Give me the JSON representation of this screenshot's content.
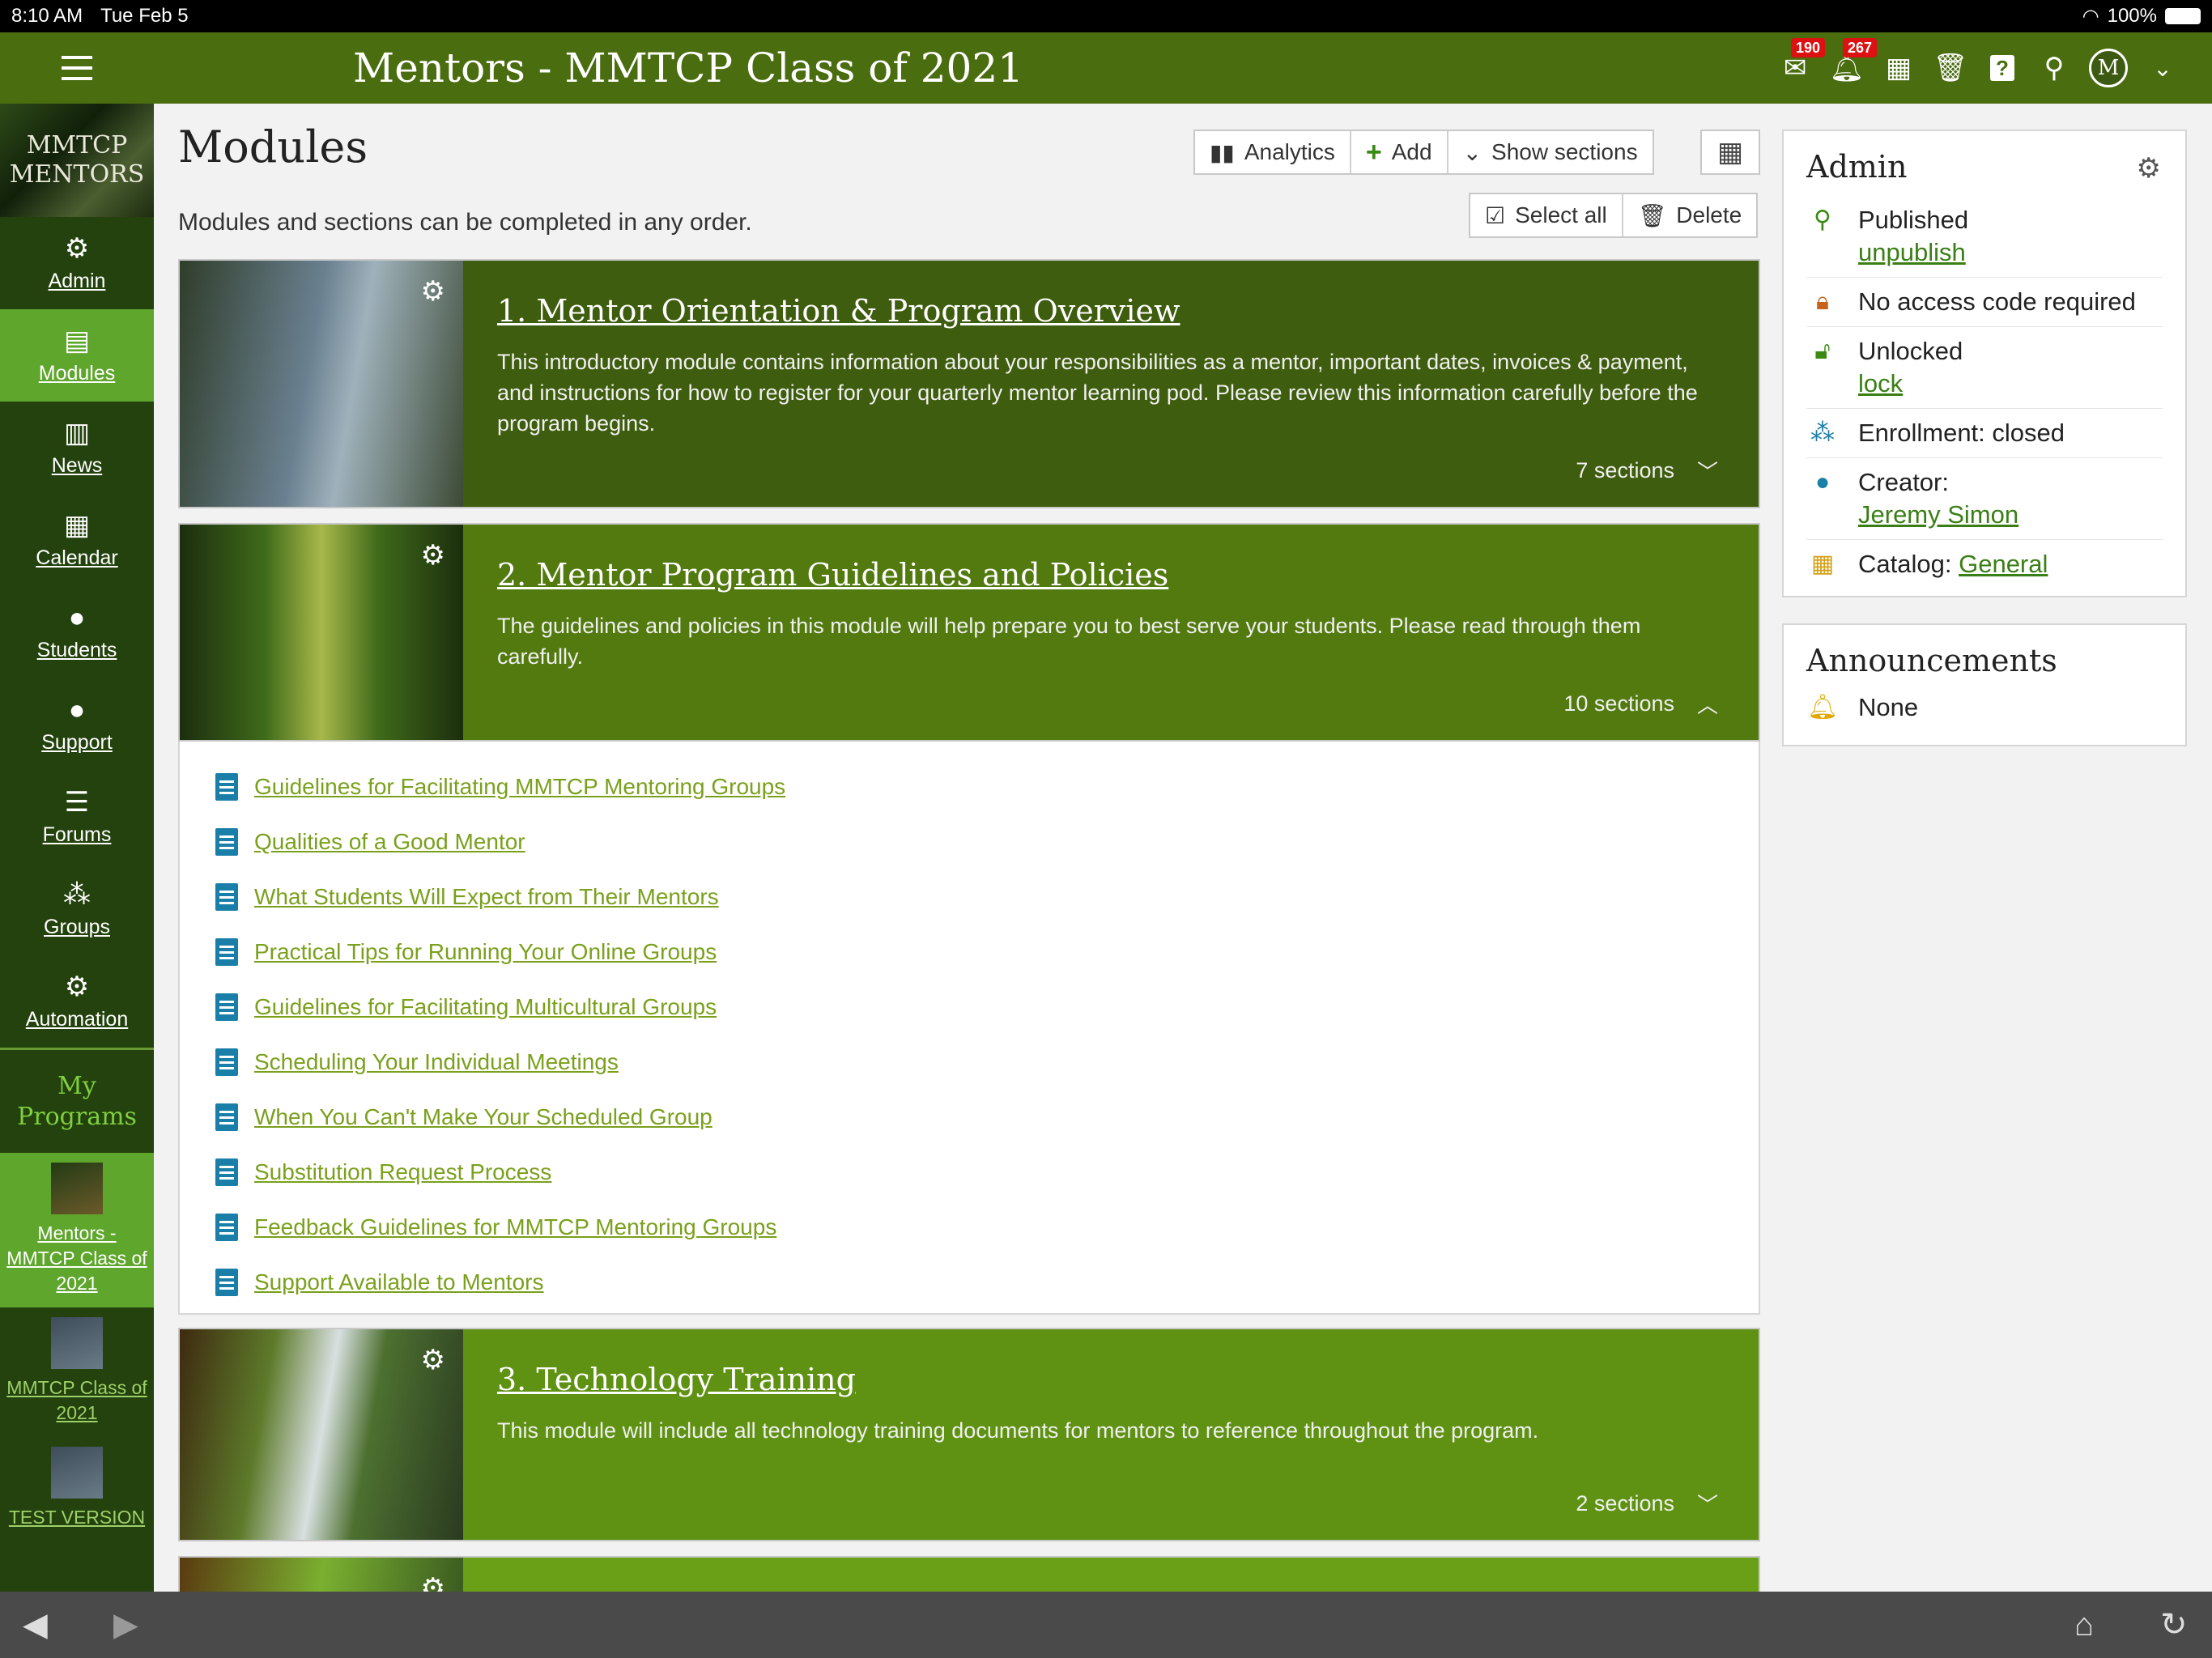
{
  "status": {
    "time": "8:10 AM",
    "date": "Tue Feb 5",
    "battery": "100%"
  },
  "app": {
    "title": "Mentors - MMTCP Class of 2021",
    "logo_text_1": "MMTCP",
    "logo_text_2": "MENTORS"
  },
  "topbar": {
    "mail_badge": "190",
    "alert_badge": "267",
    "avatar_letter": "M"
  },
  "sidebar": {
    "items": [
      {
        "label": "Admin"
      },
      {
        "label": "Modules"
      },
      {
        "label": "News"
      },
      {
        "label": "Calendar"
      },
      {
        "label": "Students"
      },
      {
        "label": "Support"
      },
      {
        "label": "Forums"
      },
      {
        "label": "Groups"
      },
      {
        "label": "Automation"
      }
    ],
    "my_programs": "My Programs",
    "programs": [
      {
        "label": "Mentors - MMTCP Class of 2021"
      },
      {
        "label": "MMTCP Class of 2021"
      },
      {
        "label": "TEST VERSION"
      }
    ]
  },
  "main": {
    "title": "Modules",
    "subtitle": "Modules and sections can be completed in any order.",
    "toolbar": {
      "analytics": "Analytics",
      "add": "Add",
      "show_sections": "Show sections",
      "select_all": "Select all",
      "delete": "Delete"
    },
    "modules": [
      {
        "title": "1. Mentor Orientation & Program Overview",
        "desc": "This introductory module contains information about your responsibilities as a mentor, important dates, invoices & payment, and instructions for how to register for your quarterly mentor learning pod. Please review this information carefully before the program begins.",
        "sections": "7 sections"
      },
      {
        "title": "2. Mentor Program Guidelines and Policies",
        "desc": "The guidelines and policies in this module will help prepare you to best serve your students. Please read through them carefully.",
        "sections": "10 sections"
      },
      {
        "title": "3. Technology Training",
        "desc": "This module will include all technology training documents for mentors to reference throughout the program.",
        "sections": "2 sections"
      }
    ],
    "section_links": [
      "Guidelines for Facilitating MMTCP Mentoring Groups",
      "Qualities of a Good Mentor",
      "What Students Will Expect from Their Mentors",
      "Practical Tips for Running Your Online Groups",
      "Guidelines for Facilitating Multicultural Groups",
      "Scheduling Your Individual Meetings",
      "When You Can't Make Your Scheduled Group",
      "Substitution Request Process",
      "Feedback Guidelines for MMTCP Mentoring Groups",
      "Support Available to Mentors"
    ]
  },
  "admin": {
    "title": "Admin",
    "published": "Published",
    "unpublish": "unpublish",
    "access": "No access code required",
    "unlocked": "Unlocked",
    "lock": "lock",
    "enrollment": "Enrollment: closed",
    "creator_label": "Creator:",
    "creator": "Jeremy Simon",
    "catalog_label": "Catalog:",
    "catalog": "General"
  },
  "announcements": {
    "title": "Announcements",
    "value": "None"
  },
  "colors": {
    "topbar": "#4a6d10",
    "sidebar": "#23420d",
    "active": "#5fa62d",
    "module1": "#3f5d0e",
    "module2": "#527a0f",
    "module3": "#5f9212",
    "link": "#7aa01c"
  }
}
